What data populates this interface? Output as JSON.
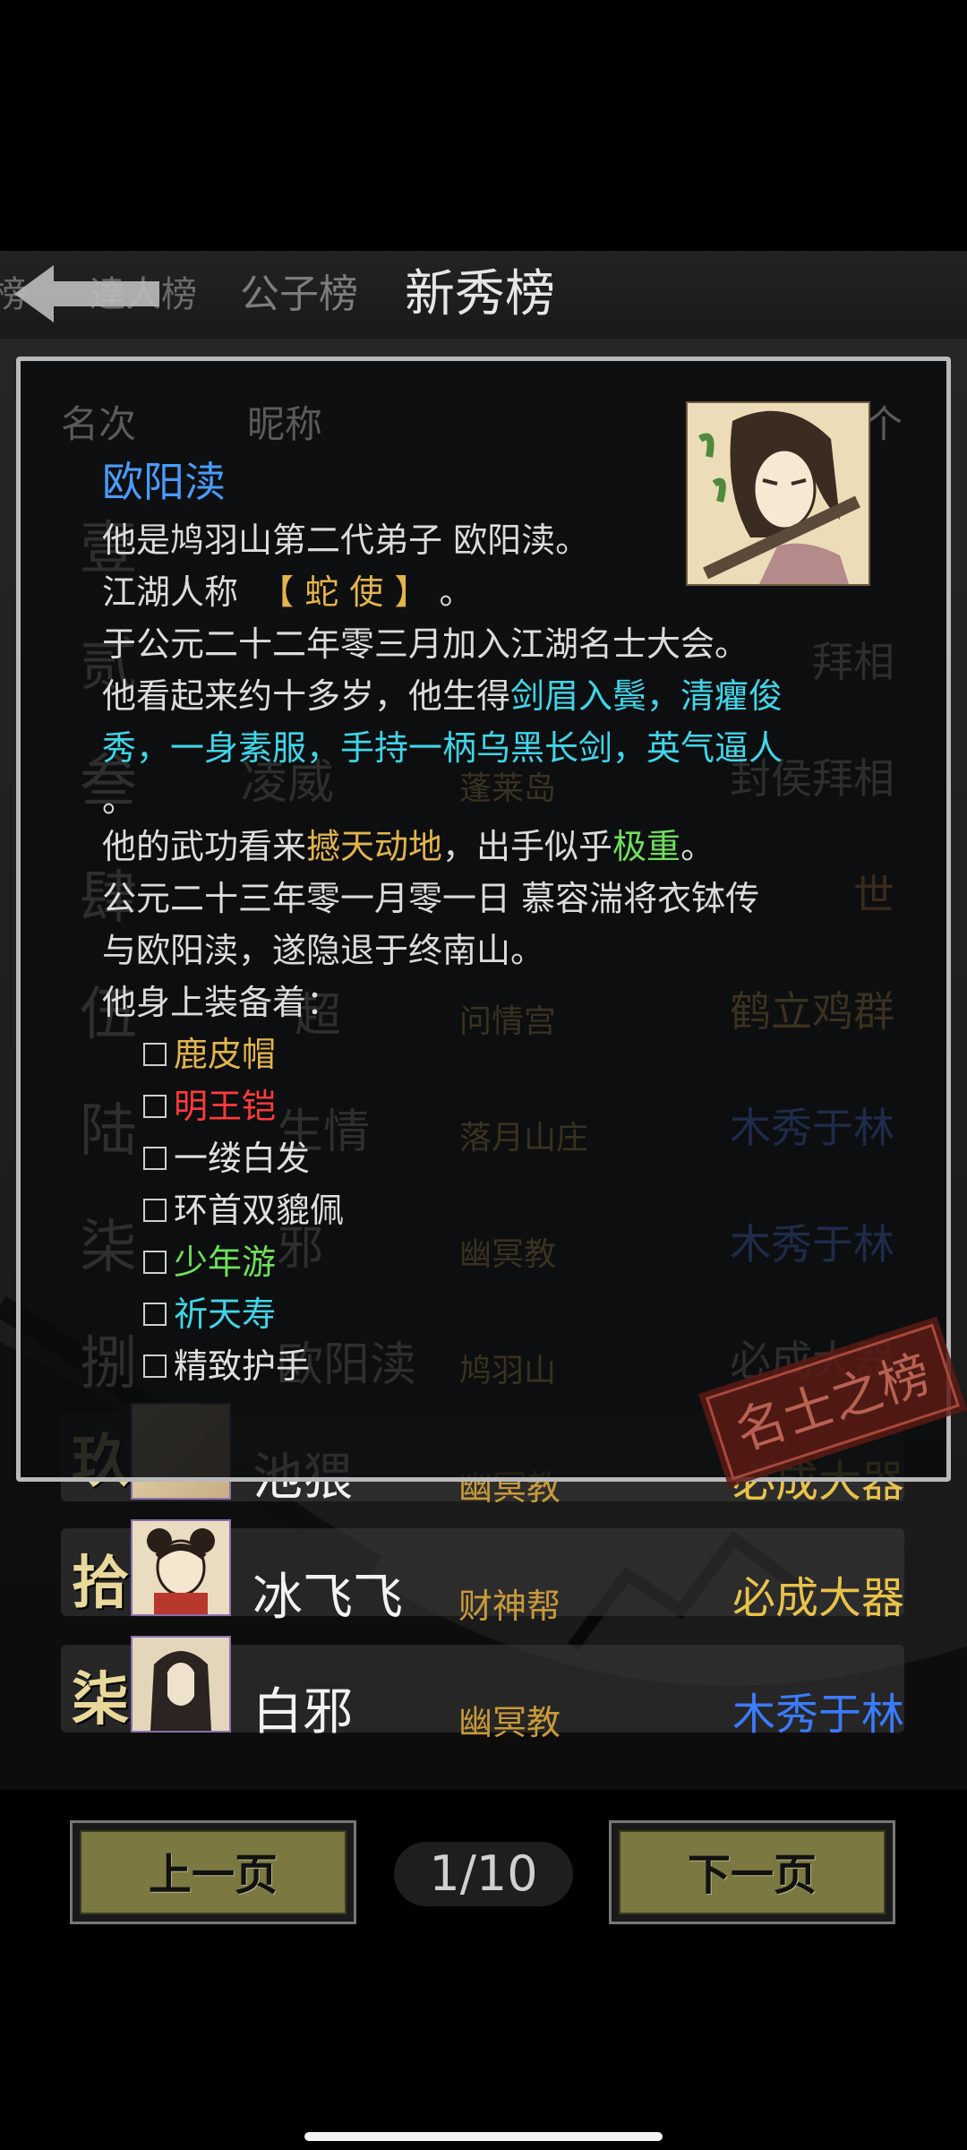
{
  "tabs": [
    "榜",
    "達人榜",
    "公子榜",
    "新秀榜"
  ],
  "list": {
    "header_rank": "名次",
    "header_name": "昵称",
    "header_right": "个",
    "rows": [
      {
        "rank": "壹",
        "name": "",
        "faction": "",
        "title": ""
      },
      {
        "rank": "贰",
        "name": "",
        "faction": "",
        "title": "拜相"
      },
      {
        "rank": "叁",
        "name": "凌威",
        "faction": "蓬莱岛",
        "title": "封侯拜相"
      },
      {
        "rank": "肆",
        "name": "",
        "faction": "",
        "title": "世"
      },
      {
        "rank": "伍",
        "name": "超",
        "faction": "问情宫",
        "title": "鹤立鸡群"
      },
      {
        "rank": "陆",
        "name": "生情",
        "faction": "落月山庄",
        "title": "木秀于林"
      },
      {
        "rank": "柒",
        "name": "邪",
        "faction": "幽冥教",
        "title": "木秀于林"
      },
      {
        "rank": "捌",
        "name": "欧阳渎",
        "faction": "鸠羽山",
        "title": "必成大器"
      },
      {
        "rank": "玖",
        "name": "池猥",
        "faction": "幽冥教",
        "title": "必成大器"
      },
      {
        "rank": "拾",
        "name": "冰飞飞",
        "faction": "财神帮",
        "title": "必成大器"
      },
      {
        "rank": "柒",
        "name": "白邪",
        "faction": "幽冥教",
        "title": "木秀于林"
      }
    ]
  },
  "detail": {
    "name": "欧阳渎",
    "line1": "他是鸠羽山第二代弟子 欧阳渎。",
    "line2_prefix": "江湖人称",
    "line2_nick": "【 蛇  使 】",
    "line2_suffix": "。",
    "line3": "于公元二十二年零三月加入江湖名士大会。",
    "line4_prefix": "他看起来约十多岁，他生得",
    "line4_hl": "剑眉入鬓，清癯俊",
    "line5_hl": "秀，一身素服，手持一柄乌黑长剑，英气逼人",
    "line6": "。",
    "line7_prefix": "他的武功看来",
    "line7_hl1": "撼天动地",
    "line7_mid": "，出手似乎",
    "line7_hl2": "极重",
    "line7_suffix": "。",
    "line8": "公元二十三年零一月零一日 慕容湍将衣钵传",
    "line9": "与欧阳渎，遂隐退于终南山。",
    "line10": "他身上装备着：",
    "equipment": [
      {
        "name": "鹿皮帽",
        "color": "#e2b44a"
      },
      {
        "name": "明王铠",
        "color": "#ff3a3a"
      },
      {
        "name": "一缕白发",
        "color": "#e0e0e0"
      },
      {
        "name": "环首双貔佩",
        "color": "#e0e0e0"
      },
      {
        "name": "少年游",
        "color": "#6ee05a"
      },
      {
        "name": "祈天寿",
        "color": "#3fd6e8"
      },
      {
        "name": "精致护手",
        "color": "#e0e0e0"
      }
    ]
  },
  "stamp_text": "名士之榜",
  "pagination": {
    "prev": "上一页",
    "indicator": "1/10",
    "next": "下一页"
  },
  "colors": {
    "title_blue": "#3b7bff",
    "title_gold": "#e8c24a",
    "title_dim": "#3a3a3a"
  }
}
